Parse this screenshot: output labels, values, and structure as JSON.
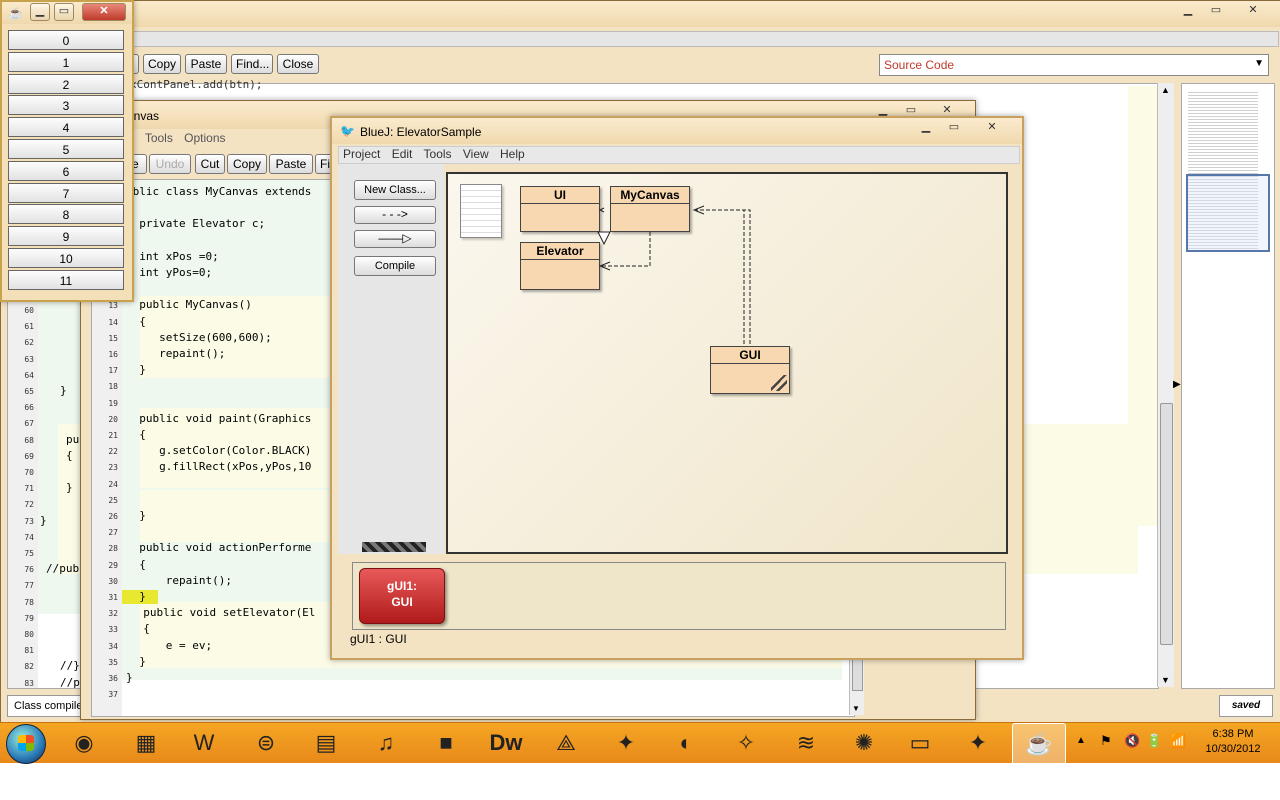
{
  "main_editor": {
    "title_fragment": "ns",
    "buttons": [
      "t",
      "Copy",
      "Paste",
      "Find...",
      "Close"
    ],
    "view_select": "Source Code",
    "partial_code": "xContPanel.add(btn);",
    "left_line_numbers": [
      "60",
      "61",
      "62",
      "63",
      "64",
      "65",
      "66",
      "67",
      "68",
      "69",
      "70",
      "71",
      "72",
      "73",
      "74",
      "75",
      "76",
      "77",
      "78",
      "79",
      "80",
      "81",
      "82",
      "83"
    ],
    "left_code": [
      {
        "line": 65,
        "text": "}"
      },
      {
        "line": 68,
        "text": "pu"
      },
      {
        "line": 69,
        "text": "{"
      },
      {
        "line": 71,
        "text": "}"
      },
      {
        "line": 73,
        "text": "}"
      },
      {
        "line": 76,
        "text": "//pub"
      },
      {
        "line": 82,
        "text": "//}"
      },
      {
        "line": 83,
        "text": "//p"
      }
    ],
    "status": "Class compile",
    "saved": "saved"
  },
  "canvas_editor": {
    "title": "anvas",
    "menu": [
      "dit",
      "Tools",
      "Options"
    ],
    "buttons": [
      "le",
      "Undo",
      "Cut",
      "Copy",
      "Paste",
      "Fi"
    ],
    "code": [
      {
        "no": "",
        "text": "ublic class MyCanvas extends"
      },
      {
        "no": "",
        "text": ""
      },
      {
        "no": "",
        "text": "  private Elevator c;"
      },
      {
        "no": "",
        "text": ""
      },
      {
        "no": "",
        "text": "  int xPos =0;"
      },
      {
        "no": "",
        "text": "  int yPos=0;"
      },
      {
        "no": "",
        "text": ""
      },
      {
        "no": "13",
        "text": "  public MyCanvas()"
      },
      {
        "no": "14",
        "text": "  {"
      },
      {
        "no": "15",
        "text": "     setSize(600,600);"
      },
      {
        "no": "16",
        "text": "     repaint();"
      },
      {
        "no": "17",
        "text": "  }"
      },
      {
        "no": "18",
        "text": ""
      },
      {
        "no": "19",
        "text": ""
      },
      {
        "no": "20",
        "text": "  public void paint(Graphics"
      },
      {
        "no": "21",
        "text": "  {"
      },
      {
        "no": "22",
        "text": "     g.setColor(Color.BLACK)"
      },
      {
        "no": "23",
        "text": "     g.fillRect(xPos,yPos,10"
      },
      {
        "no": "24",
        "text": ""
      },
      {
        "no": "25",
        "text": ""
      },
      {
        "no": "26",
        "text": "  }"
      },
      {
        "no": "27",
        "text": ""
      },
      {
        "no": "28",
        "text": "  public void actionPerforme"
      },
      {
        "no": "29",
        "text": "  {"
      },
      {
        "no": "30",
        "text": "      repaint();"
      },
      {
        "no": "31",
        "text": "  }"
      },
      {
        "no": "32",
        "text": "  public void setElevator(El"
      },
      {
        "no": "33",
        "text": "  {"
      },
      {
        "no": "34",
        "text": "      e = ev;"
      },
      {
        "no": "35",
        "text": "  }"
      },
      {
        "no": "36",
        "text": "}"
      },
      {
        "no": "37",
        "text": ""
      }
    ]
  },
  "gui_window": {
    "buttons": [
      "0",
      "1",
      "2",
      "3",
      "4",
      "5",
      "6",
      "7",
      "8",
      "9",
      "10",
      "11"
    ]
  },
  "bluej": {
    "title": "BlueJ:  ElevatorSample",
    "menu": [
      "Project",
      "Edit",
      "Tools",
      "View",
      "Help"
    ],
    "new_class": "New Class...",
    "compile": "Compile",
    "classes": [
      "UI",
      "MyCanvas",
      "Elevator",
      "GUI"
    ],
    "object": {
      "line1": "gUI1:",
      "line2": "GUI"
    },
    "status": "gUI1 : GUI"
  },
  "taskbar": {
    "apps": [
      "chrome-icon",
      "folder-icon",
      "word-icon",
      "security-icon",
      "calculator-icon",
      "itunes-icon",
      "terminal-icon",
      "dreamweaver-icon",
      "acrobat-icon",
      "bluej-icon",
      "firefox-icon",
      "bluej2-icon",
      "spotify-icon",
      "network-icon",
      "explorer-icon",
      "bluej3-icon",
      "java-icon"
    ],
    "dw_label": "Dw",
    "time": "6:38 PM",
    "date": "10/30/2012"
  }
}
